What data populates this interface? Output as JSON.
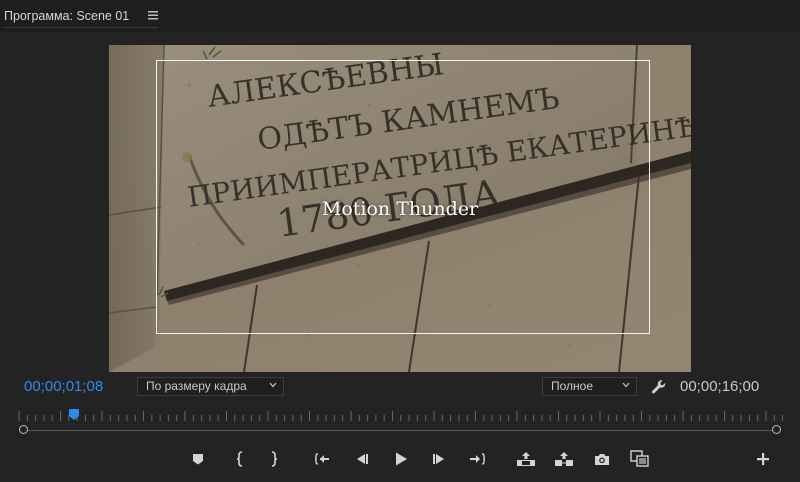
{
  "panel": {
    "title": "Программа: Scene 01"
  },
  "viewer": {
    "overlay_title": "Motion Thunder",
    "inscription_lines": [
      "АЛЕКСѢЕВНЫ",
      "ОДѢТЪ КАМНЕМЪ",
      "ПРИИМПЕРАТРИЦѢ ЕКАТЕРИНѢ II",
      "1780 ГОДА."
    ]
  },
  "timecode": {
    "current": "00;00;01;08",
    "duration": "00;00;16;00"
  },
  "playback": {
    "playhead_fraction": 0.075
  },
  "dropdowns": {
    "fit": "По размеру кадра",
    "quality": "Полное"
  },
  "colors": {
    "accent": "#2d8ceb",
    "background": "#232323",
    "icon": "#d4d4d4"
  },
  "icons": {
    "menu": "hamburger-menu-icon",
    "settings": "wrench-icon",
    "add": "plus-icon"
  }
}
